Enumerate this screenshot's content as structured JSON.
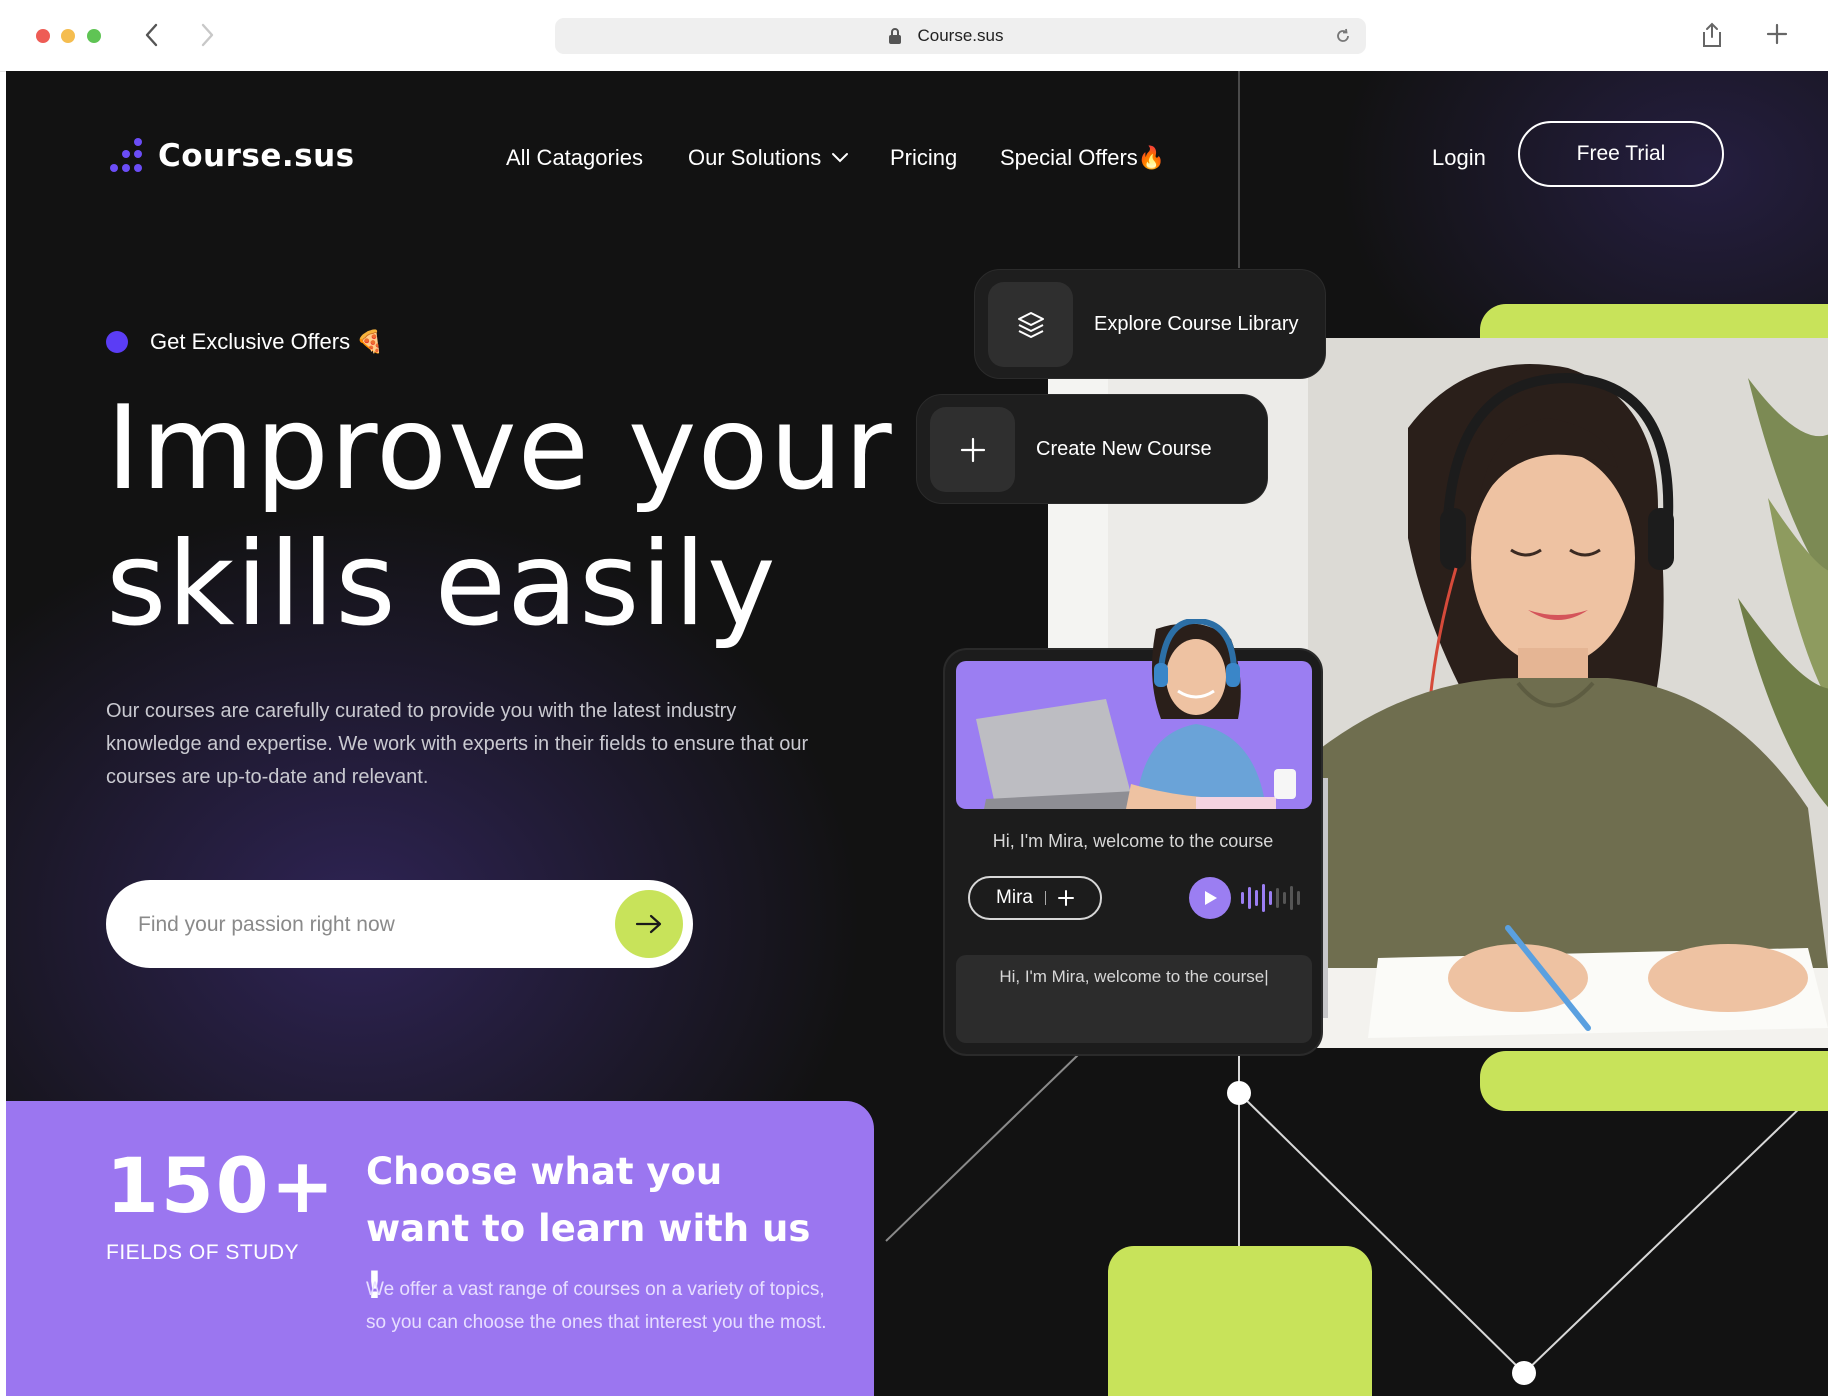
{
  "browser": {
    "url": "Course.sus"
  },
  "header": {
    "brand": "Course.sus",
    "nav": {
      "all_categories": "All Catagories",
      "our_solutions": "Our Solutions",
      "pricing": "Pricing",
      "special_offers": "Special Offers🔥"
    },
    "login": "Login",
    "free_trial": "Free Trial"
  },
  "hero": {
    "badge": "Get Exclusive Offers 🍕",
    "headline_line1": "Improve your",
    "headline_line2": "skills easily",
    "description": "Our courses are carefully curated to provide you with the latest industry knowledge and expertise. We work with experts in their fields to ensure that our courses are up-to-date and relevant.",
    "search_placeholder": "Find your passion right now"
  },
  "cards": {
    "explore": "Explore Course Library",
    "create": "Create New Course"
  },
  "avatar_card": {
    "caption": "Hi, I'm Mira, welcome to the course",
    "voice_name": "Mira",
    "script_text": "Hi, I'm Mira, welcome to the course|"
  },
  "stats": {
    "number": "150+",
    "label": "FIELDS OF STUDY",
    "title": "Choose what you want to learn with us !",
    "description": "We offer a vast range of courses on a variety of topics, so you can choose the ones that interest you the most."
  },
  "colors": {
    "accent_purple": "#9b76f0",
    "accent_green": "#c8e35a",
    "brand_blue": "#5b3df5",
    "background": "#121212"
  },
  "icons": [
    "back-icon",
    "forward-icon",
    "lock-icon",
    "reload-icon",
    "share-icon",
    "new-tab-icon",
    "logo-dots-icon",
    "chevron-down-icon",
    "arrow-right-icon",
    "layers-icon",
    "plus-icon",
    "play-icon",
    "waveform-icon"
  ]
}
